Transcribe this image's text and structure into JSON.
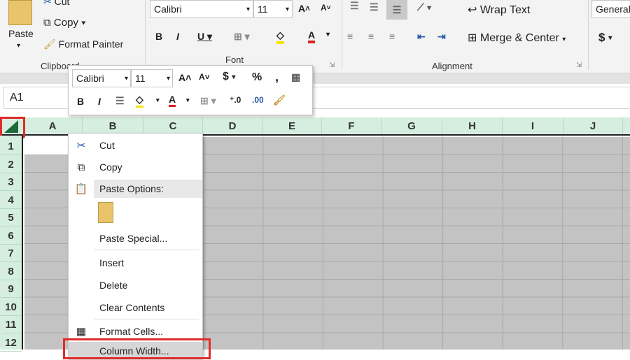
{
  "ribbon": {
    "clipboard": {
      "paste": "Paste",
      "cut": "Cut",
      "copy": "Copy",
      "format_painter": "Format Painter",
      "label": "Clipboard"
    },
    "font": {
      "font_name": "Calibri",
      "font_size": "11",
      "label": "Font"
    },
    "alignment": {
      "wrap_text": "Wrap Text",
      "merge_center": "Merge & Center",
      "label": "Alignment"
    },
    "number": {
      "format": "General",
      "currency": "$"
    }
  },
  "name_box": "A1",
  "columns": [
    "A",
    "B",
    "C",
    "D",
    "E",
    "F",
    "G",
    "H",
    "I",
    "J"
  ],
  "rows": [
    "1",
    "2",
    "3",
    "4",
    "5",
    "6",
    "7",
    "8",
    "9",
    "10",
    "11",
    "12"
  ],
  "mini_toolbar": {
    "font_name": "Calibri",
    "font_size": "11",
    "currency": "$",
    "percent": "%",
    "comma": ","
  },
  "context_menu": {
    "items": [
      "Cut",
      "Copy",
      "Paste Options:",
      "Paste Special...",
      "Insert",
      "Delete",
      "Clear Contents",
      "Format Cells...",
      "Column Width..."
    ]
  },
  "colors": {
    "highlight": "#e12a2a",
    "header_bg": "#d5eee0",
    "selected_cells": "#c3c3c3"
  }
}
